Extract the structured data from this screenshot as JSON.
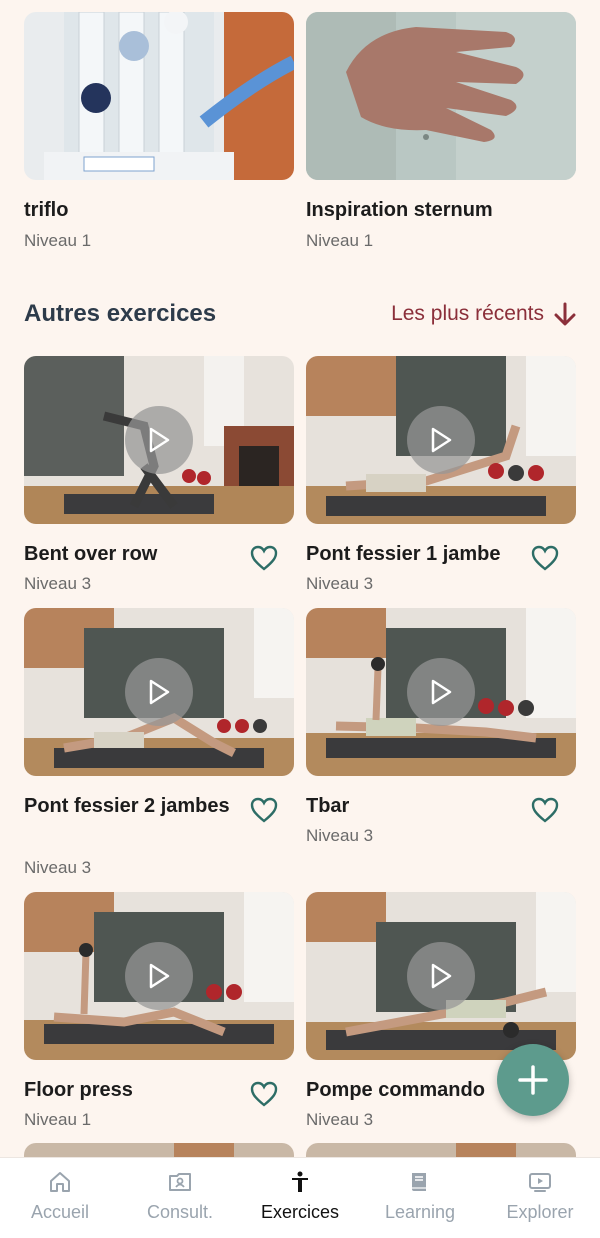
{
  "top_cards": [
    {
      "title": "triflo",
      "level": "Niveau 1"
    },
    {
      "title": "Inspiration sternum",
      "level": "Niveau 1"
    }
  ],
  "section": {
    "title": "Autres exercices",
    "sort_label": "Les plus récents"
  },
  "exercises": [
    {
      "title": "Bent over row",
      "level": "Niveau 3"
    },
    {
      "title": "Pont fessier 1 jambe",
      "level": "Niveau 3"
    },
    {
      "title": "Pont fessier 2 jambes",
      "level": "Niveau 3"
    },
    {
      "title": "Tbar",
      "level": "Niveau 3"
    },
    {
      "title": "Floor press",
      "level": "Niveau 1"
    },
    {
      "title": "Pompe commando",
      "level": "Niveau 3"
    }
  ],
  "tabs": [
    {
      "label": "Accueil",
      "icon": "home-icon",
      "active": false
    },
    {
      "label": "Consult.",
      "icon": "consult-icon",
      "active": false
    },
    {
      "label": "Exercices",
      "icon": "exercise-icon",
      "active": true
    },
    {
      "label": "Learning",
      "icon": "book-icon",
      "active": false
    },
    {
      "label": "Explorer",
      "icon": "video-icon",
      "active": false
    }
  ],
  "colors": {
    "background": "#fdf5ef",
    "accent_green": "#5d9b8d",
    "sort_red": "#8b2f3a",
    "heart_teal": "#2d6d66"
  }
}
